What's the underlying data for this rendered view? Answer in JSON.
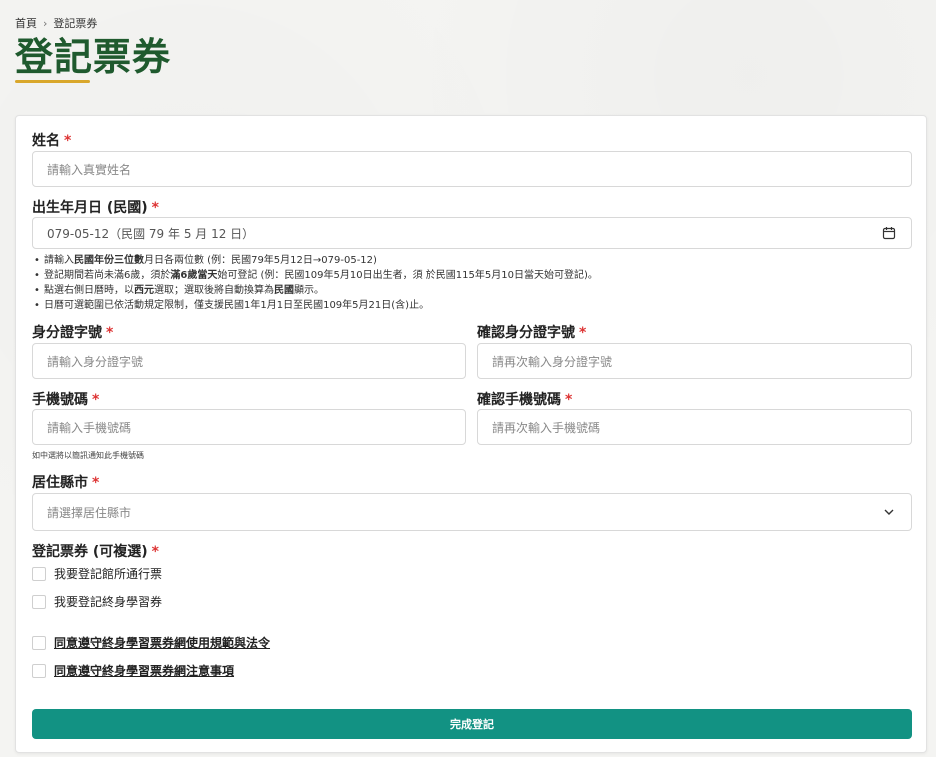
{
  "breadcrumb": {
    "home": "首頁",
    "separator": "›",
    "current": "登記票券"
  },
  "page": {
    "title": "登記票券"
  },
  "colors": {
    "title": "#1f5a2e",
    "accent_underline": "#d9a72b",
    "required": "#dd3333",
    "submit_bg": "#129283"
  },
  "form": {
    "name": {
      "label": "姓名",
      "required": "*",
      "placeholder": "請輸入真實姓名"
    },
    "birth": {
      "label": "出生年月日 (民國)",
      "required": "*",
      "value": "079-05-12（民國 79 年 5 月 12 日）",
      "icon": "calendar-icon",
      "hints": [
        {
          "pre": "請輸入",
          "b1": "民國年份三位數",
          "mid": "月日各兩位數 (例：民國79年5月12日→079-05-12)",
          "b2": "",
          "post": ""
        },
        {
          "pre": "登記期間若尚未滿6歲，須於",
          "b1": "滿6歲當天",
          "mid": "始可登記 (例：民國109年5月10日出生者，須 於民國115年5月10日當天始可登記)。",
          "b2": "",
          "post": ""
        },
        {
          "pre": "點選右側日曆時，以",
          "b1": "西元",
          "mid": "選取；選取後將自動換算為",
          "b2": "民國",
          "post": "顯示。"
        },
        {
          "pre": "日曆可選範圍已依活動規定限制，僅支援民國1年1月1日至民國109年5月21日(含)止。",
          "b1": "",
          "mid": "",
          "b2": "",
          "post": ""
        }
      ]
    },
    "id": {
      "label": "身分證字號",
      "required": "*",
      "placeholder": "請輸入身分證字號"
    },
    "id_confirm": {
      "label": "確認身分證字號",
      "required": "*",
      "placeholder": "請再次輸入身分證字號"
    },
    "phone": {
      "label": "手機號碼",
      "required": "*",
      "placeholder": "請輸入手機號碼"
    },
    "phone_confirm": {
      "label": "確認手機號碼",
      "required": "*",
      "placeholder": "請再次輸入手機號碼"
    },
    "phone_note": "如中選將以簡訊通知此手機號碼",
    "city": {
      "label": "居住縣市",
      "required": "*",
      "placeholder": "請選擇居住縣市",
      "icon": "chevron-down-icon"
    },
    "tickets": {
      "label": "登記票券 (可複選)",
      "required": "*",
      "options": [
        "我要登記館所通行票",
        "我要登記終身學習券"
      ]
    },
    "agreements": [
      "同意遵守終身學習票券網使用規範與法令",
      "同意遵守終身學習票券網注意事項"
    ],
    "submit_label": "完成登記"
  }
}
